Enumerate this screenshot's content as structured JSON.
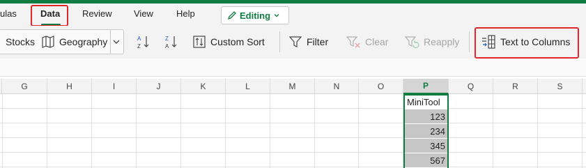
{
  "tabs": [
    {
      "label": "ulas"
    },
    {
      "label": "Data"
    },
    {
      "label": "Review"
    },
    {
      "label": "View"
    },
    {
      "label": "Help"
    }
  ],
  "editing": {
    "label": "Editing"
  },
  "ribbon": {
    "stocks": "Stocks",
    "geography": "Geography",
    "sort_az_icon": "sort-ascending-icon",
    "sort_za_icon": "sort-descending-icon",
    "custom_sort": "Custom Sort",
    "filter": "Filter",
    "clear": "Clear",
    "reapply": "Reapply",
    "text_to_columns": "Text to Columns"
  },
  "columns": [
    "G",
    "H",
    "I",
    "J",
    "K",
    "L",
    "M",
    "N",
    "O",
    "P",
    "Q",
    "R",
    "S"
  ],
  "selected_column": "P",
  "cells": {
    "header": "MiniTool",
    "values": [
      "123",
      "234",
      "345",
      "567"
    ]
  },
  "colors": {
    "accent": "#107c41",
    "highlight": "#e0262b",
    "selection_fill": "#c6c6c6"
  }
}
